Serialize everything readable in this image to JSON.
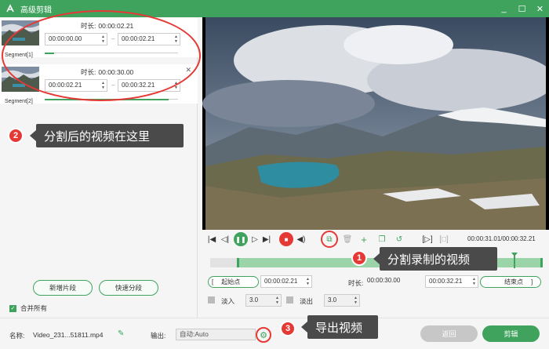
{
  "window": {
    "title": "高级剪辑",
    "controls": [
      "_",
      "☐",
      "✕"
    ]
  },
  "segments": [
    {
      "label": "Segment[1]",
      "duration_label": "时长:",
      "duration": "00:00:02.21",
      "start": "00:00:00.00",
      "end": "00:00:02.21",
      "progress": 0.07
    },
    {
      "label": "Segment[2]",
      "duration_label": "时长:",
      "duration": "00:00:30.00",
      "start": "00:00:02.21",
      "end": "00:00:32.21",
      "progress": 0.93
    }
  ],
  "callouts": [
    {
      "number": "2",
      "text": "分割后的视频在这里"
    },
    {
      "number": "1",
      "text": "分割录制的视频"
    },
    {
      "number": "3",
      "text": "导出视频"
    }
  ],
  "left_buttons": {
    "new_segment": "新增片段",
    "quick_split": "快速分段"
  },
  "merge_all": "合并所有",
  "player": {
    "timecode": "00:00:31.01/00:00:32.21",
    "playhead_fraction": 0.93
  },
  "trim": {
    "start_label": "起始点",
    "start_value": "00:00:02.21",
    "duration_label": "时长:",
    "duration_value": "00:00:30.00",
    "end_value": "00:00:32.21",
    "end_label": "结束点"
  },
  "fade": {
    "in_label": "淡入",
    "in_value": "3.0",
    "out_label": "淡出",
    "out_value": "3.0"
  },
  "bottom": {
    "name_label": "名称:",
    "filename": "Video_231...51811.mp4",
    "export_label": "输出:",
    "export_value": "自动:Auto",
    "back_button": "返回",
    "cut_button": "剪辑"
  },
  "colors": {
    "accent": "#3fa35e",
    "annotation": "#e53935",
    "callout_bg": "#4a4a4a"
  }
}
